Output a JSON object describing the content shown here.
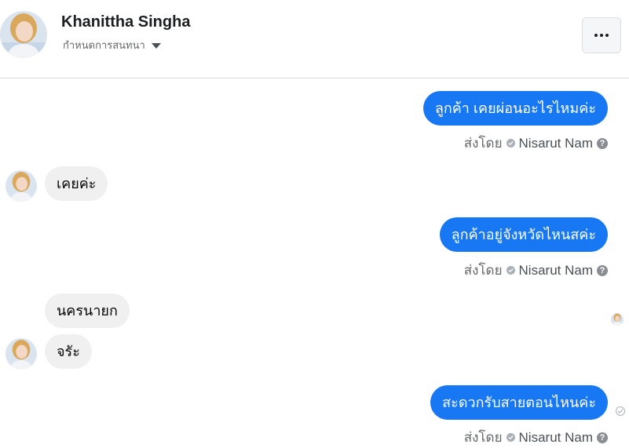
{
  "header": {
    "contact_name": "Khanittha Singha",
    "subtitle": "กำหนดการสนทนา",
    "more_label": "..."
  },
  "messages": [
    {
      "from": "agent",
      "text": "ลูกค้า เคยผ่อนอะไรไหมค่ะ",
      "sent_by_label": "ส่งโดย",
      "agent_name": "Nisarut Nam"
    },
    {
      "from": "customer",
      "text": "เคยค่ะ"
    },
    {
      "from": "agent",
      "text": "ลูกค้าอยู่จังหวัดไหนสค่ะ",
      "sent_by_label": "ส่งโดย",
      "agent_name": "Nisarut Nam"
    },
    {
      "from": "customer",
      "text": "นครนายก"
    },
    {
      "from": "customer",
      "text": "จรัะ"
    },
    {
      "from": "agent",
      "text": "สะดวกรับสายตอนไหนค่ะ",
      "sent_by_label": "ส่งโดย",
      "agent_name": "Nisarut Nam"
    }
  ],
  "colors": {
    "outgoing_bubble": "#1877f2",
    "incoming_bubble": "#f0f0f0",
    "muted_text": "#65676b"
  }
}
